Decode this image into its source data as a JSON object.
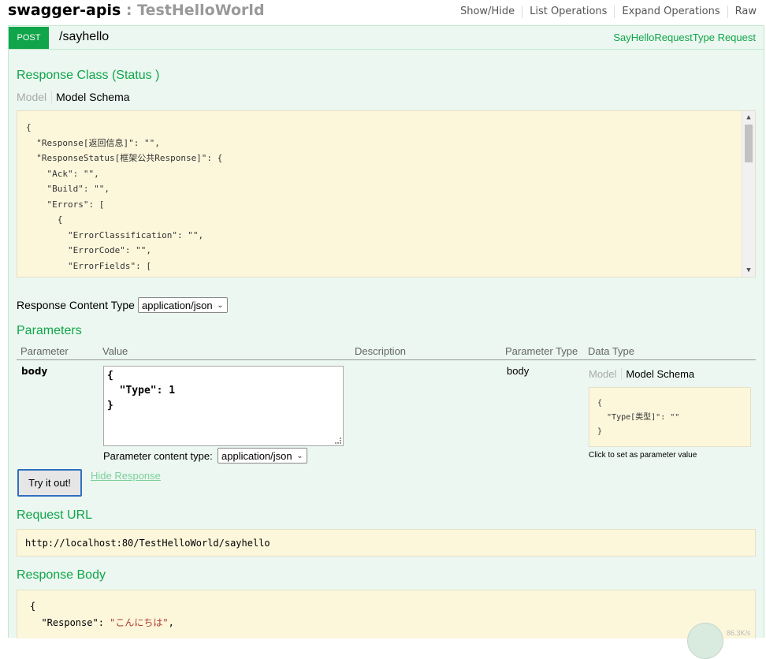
{
  "header": {
    "app_name": "swagger-apis",
    "separator": ":",
    "api_name": "TestHelloWorld",
    "nav": [
      "Show/Hide",
      "List Operations",
      "Expand Operations",
      "Raw"
    ]
  },
  "operation": {
    "method": "POST",
    "path": "/sayhello",
    "summary": "SayHelloRequestType Request"
  },
  "response_class": {
    "title": "Response Class (Status )",
    "tab_model": "Model",
    "tab_schema": "Model Schema",
    "schema_lines": [
      "{",
      "  \"Response[返回信息]\": \"\",",
      "  \"ResponseStatus[框架公共Response]\": {",
      "    \"Ack\": \"\",",
      "    \"Build\": \"\",",
      "    \"Errors\": [",
      "      {",
      "        \"ErrorClassification\": \"\",",
      "        \"ErrorCode\": \"\",",
      "        \"ErrorFields\": ["
    ]
  },
  "response_content_type": {
    "label": "Response Content Type",
    "value": "application/json"
  },
  "parameters": {
    "title": "Parameters",
    "headers": [
      "Parameter",
      "Value",
      "Description",
      "Parameter Type",
      "Data Type"
    ],
    "row": {
      "name": "body",
      "value_lines": [
        "{",
        "  \"Type\": 1",
        "}"
      ],
      "param_type": "body",
      "tab_model": "Model",
      "tab_schema": "Model Schema",
      "schema_lines": [
        "{",
        "  \"Type[类型]\": \"\"",
        "}"
      ],
      "hint": "Click to set as parameter value",
      "content_type_label": "Parameter content type:",
      "content_type_value": "application/json"
    }
  },
  "actions": {
    "try_label": "Try it out!",
    "hide_label": "Hide Response"
  },
  "request_url": {
    "title": "Request URL",
    "value": "http://localhost:80/TestHelloWorld/sayhello"
  },
  "response_body": {
    "title": "Response Body",
    "line1": "{",
    "line2_key": "  \"Response\": ",
    "line2_value": "\"こんにちは\"",
    "line2_tail": ","
  },
  "tray": {
    "speed": "86.3K/s"
  },
  "colors": {
    "accent": "#10a54a",
    "op_bg": "#ebf7f0",
    "code_bg": "#fcf6db"
  }
}
